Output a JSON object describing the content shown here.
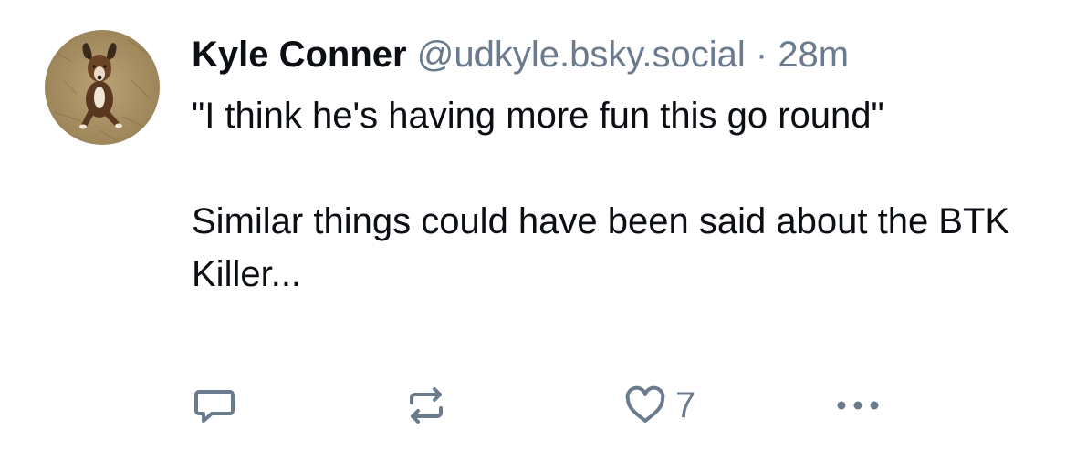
{
  "post": {
    "author_name": "Kyle Conner",
    "handle": "@udkyle.bsky.social",
    "separator": "·",
    "time": "28m",
    "text_lines": [
      "\"I think he's having more fun this go round\"",
      "Similar things could have been said about the BTK Killer..."
    ],
    "like_count": "7"
  },
  "icons": {
    "avatar": "dog-photo-avatar",
    "reply": "speech-bubble-icon",
    "repost": "repost-arrows-icon",
    "like": "heart-icon",
    "more": "more-dots-icon"
  },
  "colors": {
    "text": "#0b0f14",
    "muted": "#6b7b8e",
    "icon": "#6b7b8e"
  }
}
